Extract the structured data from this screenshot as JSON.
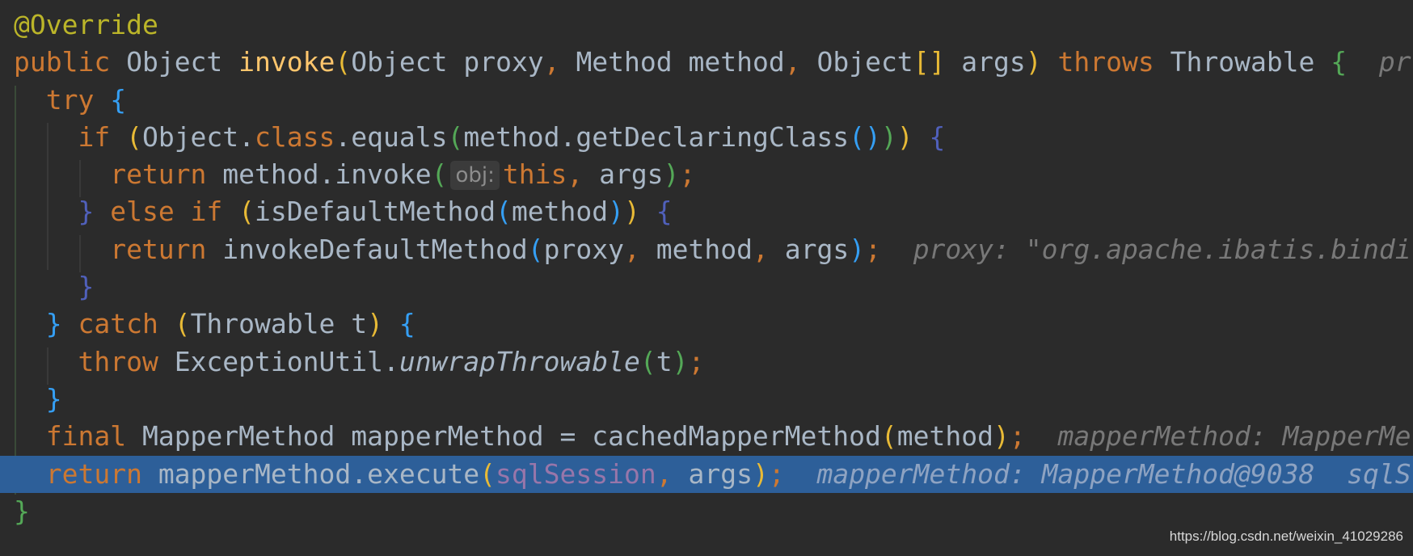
{
  "selected_line": 12,
  "colors": {
    "background": "#2b2b2b",
    "selection": "#2d5f99",
    "keyword": "#cc7832",
    "identifier": "#a9b7c6",
    "annotation": "#bbb529",
    "method_decl": "#ffc66d",
    "field": "#9876aa",
    "hint": "#787878"
  },
  "lines": [
    {
      "tokens": [
        {
          "t": "@Override",
          "c": "ann"
        }
      ]
    },
    {
      "tokens": [
        {
          "t": "public",
          "c": "kw"
        },
        {
          "t": " Object ",
          "c": "id"
        },
        {
          "t": "invoke",
          "c": "fn"
        },
        {
          "t": "(",
          "c": "by"
        },
        {
          "t": "Object proxy",
          "c": "id"
        },
        {
          "t": ", ",
          "c": "kw"
        },
        {
          "t": "Method method",
          "c": "id"
        },
        {
          "t": ", ",
          "c": "kw"
        },
        {
          "t": "Object",
          "c": "id"
        },
        {
          "t": "[]",
          "c": "by"
        },
        {
          "t": " args",
          "c": "id"
        },
        {
          "t": ")",
          "c": "by"
        },
        {
          "t": " throws ",
          "c": "kw"
        },
        {
          "t": "Throwable ",
          "c": "id"
        },
        {
          "t": "{",
          "c": "bg"
        },
        {
          "t": "  pr",
          "c": "hint"
        }
      ]
    },
    {
      "tokens": [
        {
          "t": "  try ",
          "c": "kw"
        },
        {
          "t": "{",
          "c": "bb"
        }
      ]
    },
    {
      "tokens": [
        {
          "t": "    if ",
          "c": "kw"
        },
        {
          "t": "(",
          "c": "by"
        },
        {
          "t": "Object.",
          "c": "id"
        },
        {
          "t": "class",
          "c": "kw"
        },
        {
          "t": ".equals",
          "c": "id"
        },
        {
          "t": "(",
          "c": "bg"
        },
        {
          "t": "method.getDeclaringClass",
          "c": "id"
        },
        {
          "t": "()",
          "c": "bb"
        },
        {
          "t": ")",
          "c": "bg"
        },
        {
          "t": ")",
          "c": "by"
        },
        {
          "t": " ",
          "c": "id"
        },
        {
          "t": "{",
          "c": "bp"
        }
      ]
    },
    {
      "tokens": [
        {
          "t": "      return ",
          "c": "kw"
        },
        {
          "t": "method.invoke",
          "c": "id"
        },
        {
          "t": "(",
          "c": "bg"
        },
        {
          "t": "obj:",
          "c": "inlay"
        },
        {
          "t": "this",
          "c": "kw"
        },
        {
          "t": ", ",
          "c": "kw"
        },
        {
          "t": "args",
          "c": "id"
        },
        {
          "t": ")",
          "c": "bg"
        },
        {
          "t": ";",
          "c": "kw"
        }
      ]
    },
    {
      "tokens": [
        {
          "t": "    ",
          "c": "id"
        },
        {
          "t": "}",
          "c": "bp"
        },
        {
          "t": " else if ",
          "c": "kw"
        },
        {
          "t": "(",
          "c": "by"
        },
        {
          "t": "isDefaultMethod",
          "c": "id"
        },
        {
          "t": "(",
          "c": "bb"
        },
        {
          "t": "method",
          "c": "id"
        },
        {
          "t": ")",
          "c": "bb"
        },
        {
          "t": ")",
          "c": "by"
        },
        {
          "t": " ",
          "c": "id"
        },
        {
          "t": "{",
          "c": "bp"
        }
      ]
    },
    {
      "tokens": [
        {
          "t": "      return ",
          "c": "kw"
        },
        {
          "t": "invokeDefaultMethod",
          "c": "id"
        },
        {
          "t": "(",
          "c": "bb"
        },
        {
          "t": "proxy",
          "c": "id"
        },
        {
          "t": ", ",
          "c": "kw"
        },
        {
          "t": "method",
          "c": "id"
        },
        {
          "t": ", ",
          "c": "kw"
        },
        {
          "t": "args",
          "c": "id"
        },
        {
          "t": ")",
          "c": "bb"
        },
        {
          "t": ";",
          "c": "kw"
        },
        {
          "t": "  proxy: \"org.apache.ibatis.bindi",
          "c": "hint"
        }
      ]
    },
    {
      "tokens": [
        {
          "t": "    }",
          "c": "bp"
        }
      ]
    },
    {
      "tokens": [
        {
          "t": "  }",
          "c": "bb"
        },
        {
          "t": " catch ",
          "c": "kw"
        },
        {
          "t": "(",
          "c": "by"
        },
        {
          "t": "Throwable t",
          "c": "id"
        },
        {
          "t": ")",
          "c": "by"
        },
        {
          "t": " {",
          "c": "bb"
        }
      ]
    },
    {
      "tokens": [
        {
          "t": "    throw ",
          "c": "kw"
        },
        {
          "t": "ExceptionUtil.",
          "c": "id"
        },
        {
          "t": "unwrapThrowable",
          "c": "ital"
        },
        {
          "t": "(",
          "c": "bg"
        },
        {
          "t": "t",
          "c": "id"
        },
        {
          "t": ")",
          "c": "bg"
        },
        {
          "t": ";",
          "c": "kw"
        }
      ]
    },
    {
      "tokens": [
        {
          "t": "  }",
          "c": "bb"
        }
      ]
    },
    {
      "tokens": [
        {
          "t": "  final ",
          "c": "kw"
        },
        {
          "t": "MapperMethod mapperMethod = cachedMapperMethod",
          "c": "id"
        },
        {
          "t": "(",
          "c": "by"
        },
        {
          "t": "method",
          "c": "id"
        },
        {
          "t": ")",
          "c": "by"
        },
        {
          "t": ";",
          "c": "kw"
        },
        {
          "t": "  mapperMethod: MapperMe",
          "c": "hint"
        }
      ]
    },
    {
      "tokens": [
        {
          "t": "  return ",
          "c": "kw"
        },
        {
          "t": "mapperMethod.execute",
          "c": "id"
        },
        {
          "t": "(",
          "c": "by"
        },
        {
          "t": "sqlSession",
          "c": "fld"
        },
        {
          "t": ", ",
          "c": "kw"
        },
        {
          "t": "args",
          "c": "id"
        },
        {
          "t": ")",
          "c": "by"
        },
        {
          "t": ";",
          "c": "kw"
        },
        {
          "t": "  mapperMethod: MapperMethod@9038  sqlS",
          "c": "hint"
        }
      ]
    },
    {
      "tokens": [
        {
          "t": "}",
          "c": "bg"
        }
      ]
    }
  ],
  "watermark": "https://blog.csdn.net/weixin_41029286"
}
